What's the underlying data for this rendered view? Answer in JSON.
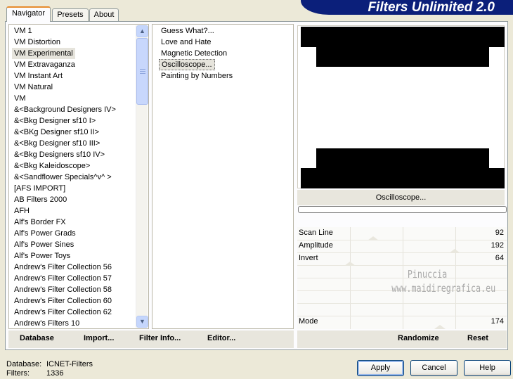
{
  "app_title": "Filters Unlimited 2.0",
  "tabs": [
    "Navigator",
    "Presets",
    "About"
  ],
  "categories": [
    "VM 1",
    "VM Distortion",
    "VM Experimental",
    "VM Extravaganza",
    "VM Instant Art",
    "VM Natural",
    "VM",
    "&<Background Designers IV>",
    "&<Bkg Designer sf10 I>",
    "&<BKg Designer sf10 II>",
    "&<Bkg Designer sf10 III>",
    "&<Bkg Designers sf10 IV>",
    "&<Bkg Kaleidoscope>",
    "&<Sandflower Specials^v^ >",
    "[AFS IMPORT]",
    "AB Filters 2000",
    "AFH",
    "Alf's Border FX",
    "Alf's Power Grads",
    "Alf's Power Sines",
    "Alf's Power Toys",
    "Andrew's Filter Collection 56",
    "Andrew's Filter Collection 57",
    "Andrew's Filter Collection 58",
    "Andrew's Filter Collection 60",
    "Andrew's Filter Collection 62",
    "Andrew's Filters 10"
  ],
  "selected_category": "VM Experimental",
  "filters": [
    "Guess  What?...",
    "Love and Hate",
    "Magnetic Detection",
    "Oscilloscope...",
    "Painting by Numbers"
  ],
  "selected_filter": "Oscilloscope...",
  "preview_label": "Oscilloscope...",
  "progress": 0,
  "sliders": [
    {
      "label": "Scan Line",
      "value": 92,
      "fraction": 0.361
    },
    {
      "label": "Amplitude",
      "value": 192,
      "fraction": 0.753
    },
    {
      "label": "Invert",
      "value": 64,
      "fraction": 0.251
    }
  ],
  "mode": {
    "label": "Mode",
    "value": 174,
    "fraction": 0.682
  },
  "watermark": [
    "Pinuccia",
    "www.maidiregrafica.eu"
  ],
  "left_buttons": {
    "database": "Database",
    "import": "Import...",
    "filter_info": "Filter Info...",
    "editor": "Editor..."
  },
  "right_buttons": {
    "randomize": "Randomize",
    "reset": "Reset"
  },
  "dialog_buttons": {
    "apply": "Apply",
    "cancel": "Cancel",
    "help": "Help"
  },
  "status": {
    "database_label": "Database:",
    "database_value": "ICNET-Filters",
    "filters_label": "Filters:",
    "filters_value": "1336"
  }
}
